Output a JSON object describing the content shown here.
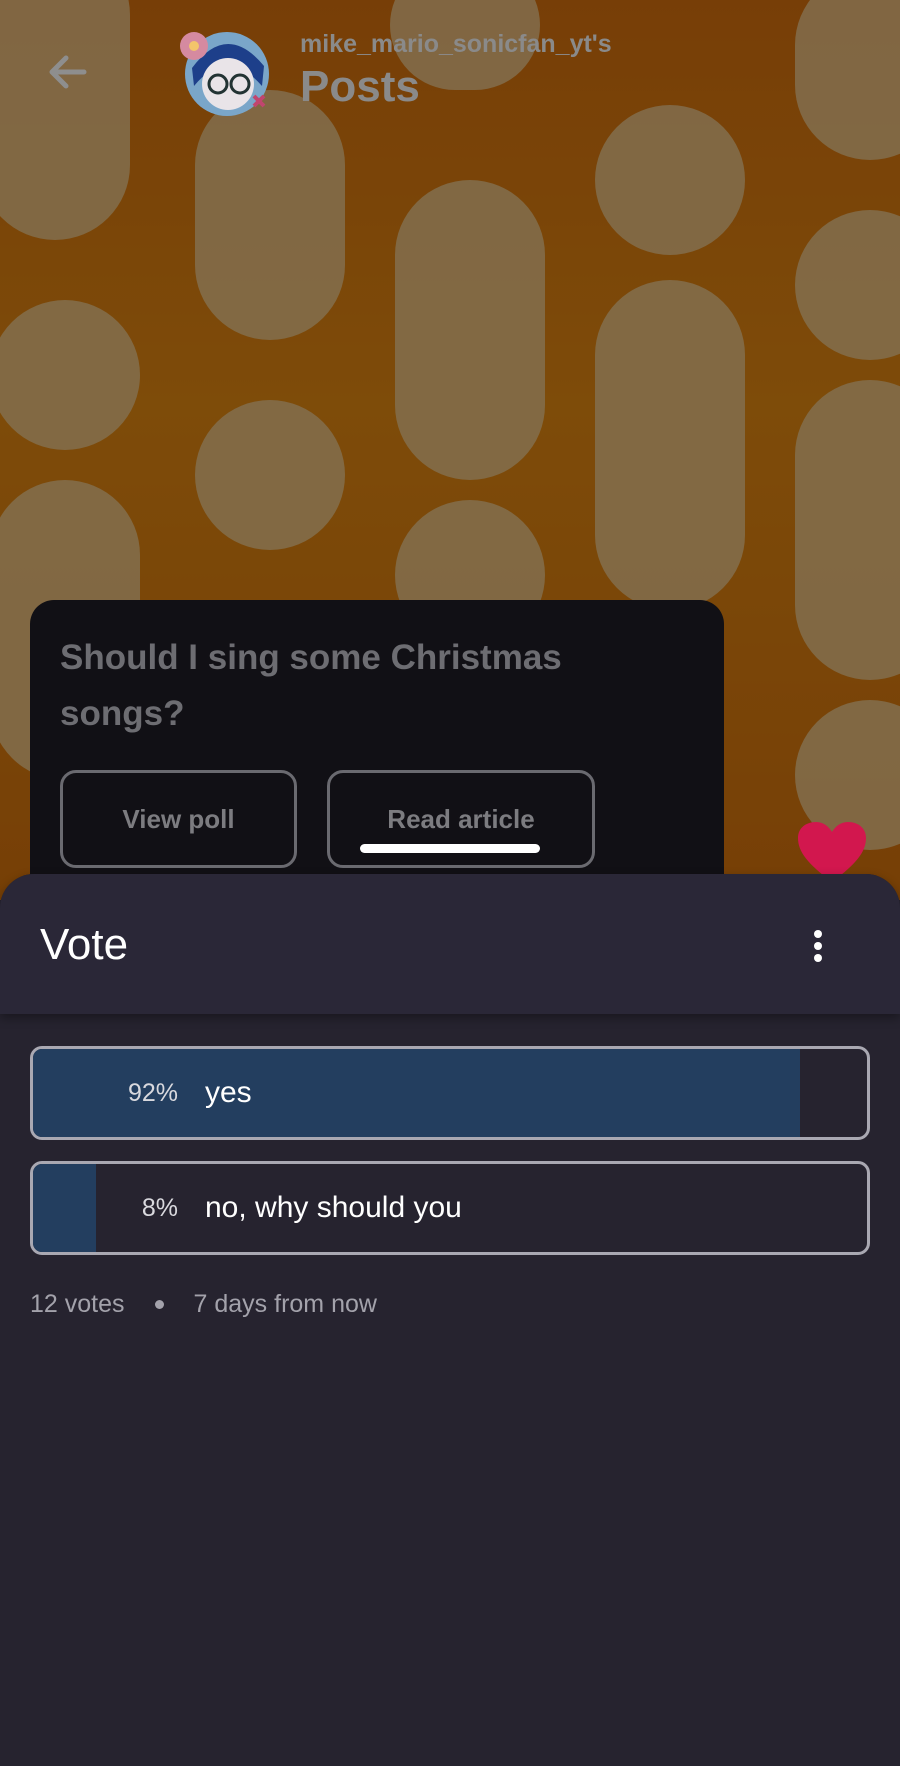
{
  "header": {
    "owner": "mike_mario_sonicfan_yt's",
    "title": "Posts"
  },
  "post": {
    "title": "Should I sing some Christmas songs?",
    "view_poll_label": "View poll",
    "read_article_label": "Read article"
  },
  "sheet": {
    "title": "Vote",
    "options": [
      {
        "percent_text": "92%",
        "percent": 92,
        "label": "yes"
      },
      {
        "percent_text": "8%",
        "percent": 8,
        "label": "no, why should you"
      }
    ],
    "votes": "12 votes",
    "deadline": "7 days from now"
  },
  "colors": {
    "background_orange": "#e58a12",
    "sheet_bg": "#26232f",
    "bar_fill": "#233e5f",
    "heart": "#d2174e"
  },
  "icons": [
    "back-arrow-icon",
    "avatar",
    "heart-icon",
    "more-vert-icon"
  ]
}
